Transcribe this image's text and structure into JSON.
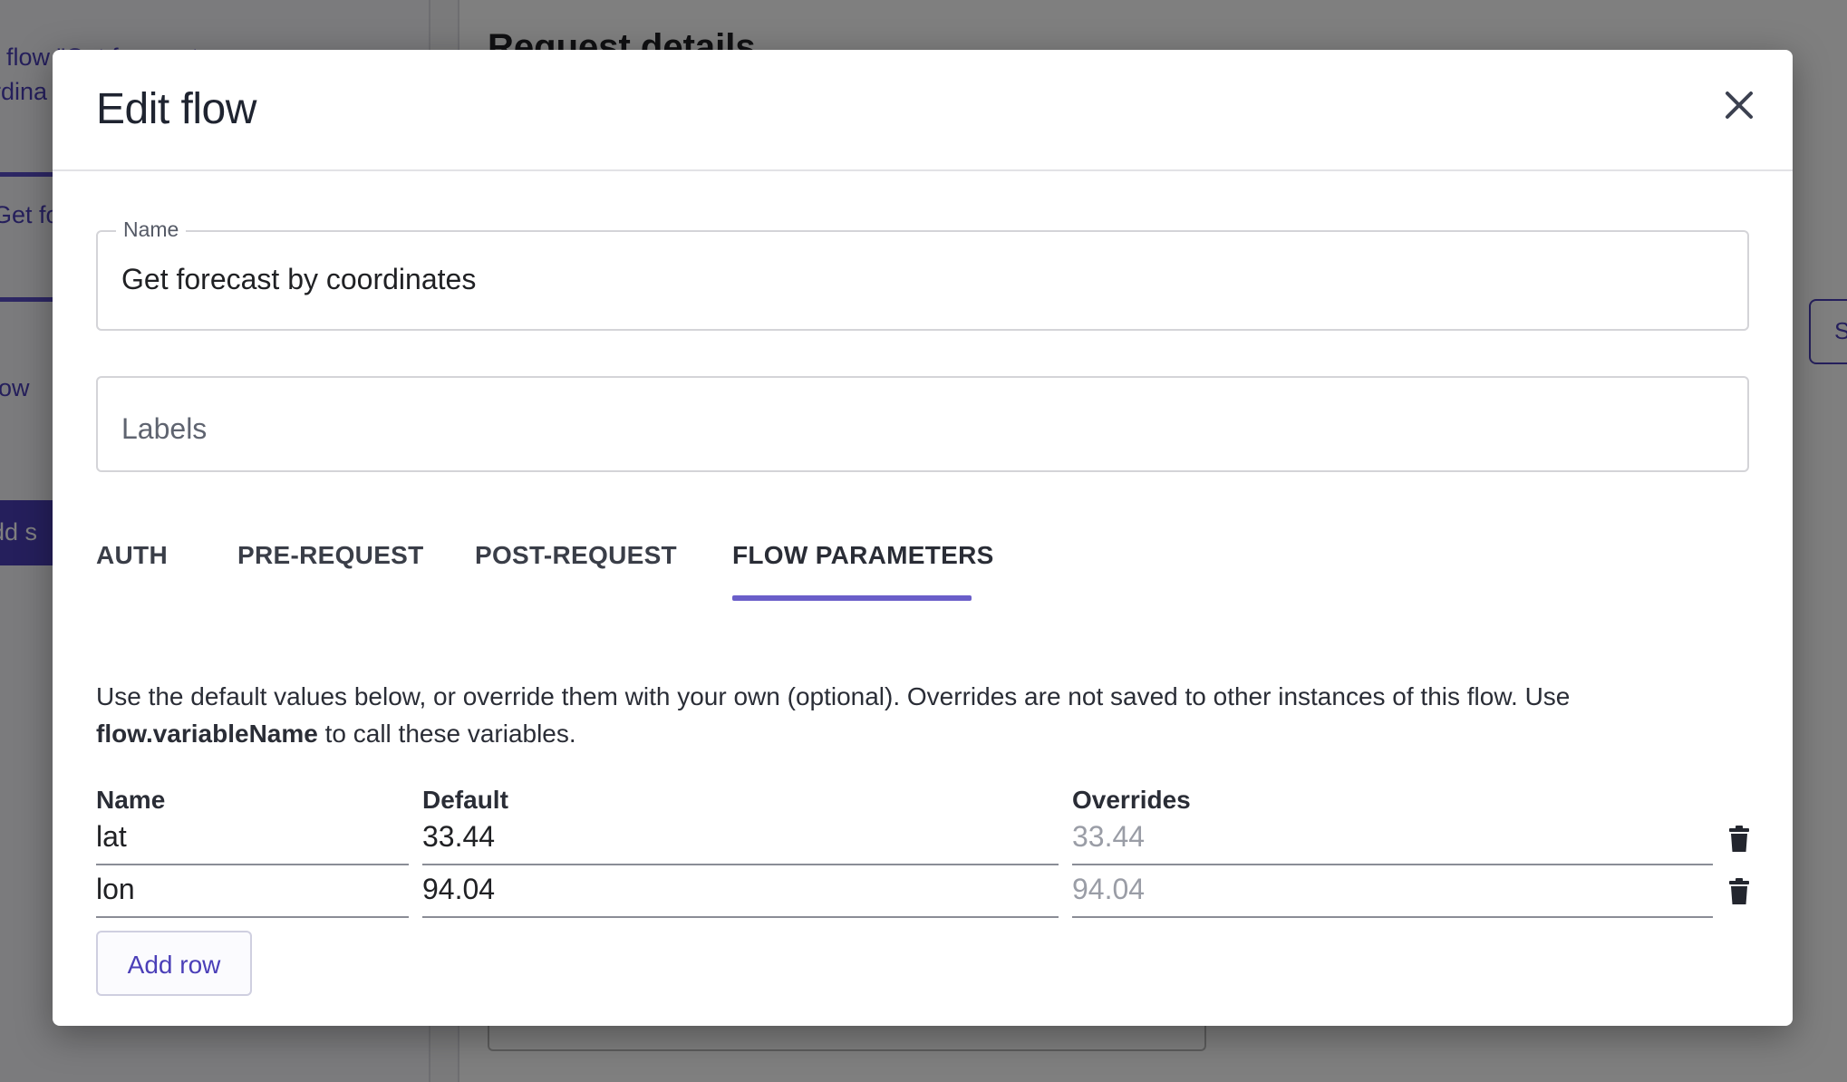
{
  "background": {
    "sidebar_flow_line1": "t flow \"Get forecast",
    "sidebar_flow_line2": "rdina",
    "sidebar_get_fo": "Get fo",
    "sidebar_low": "low",
    "sidebar_add_button": "dd s",
    "main_title": "Request details",
    "side_button": "S"
  },
  "modal": {
    "title": "Edit flow",
    "close_icon": "close-icon",
    "name_field": {
      "legend": "Name",
      "value": "Get forecast by coordinates"
    },
    "labels_field": {
      "placeholder": "Labels"
    },
    "tabs": [
      {
        "label": "AUTH",
        "active": false
      },
      {
        "label": "PRE-REQUEST",
        "active": false
      },
      {
        "label": "POST-REQUEST",
        "active": false
      },
      {
        "label": "FLOW PARAMETERS",
        "active": true
      }
    ],
    "description": {
      "part1": "Use the default values below, or override them with your own (optional). Overrides are not saved to other instances of this flow. Use ",
      "bold": "flow.variableName",
      "part2": " to call these variables."
    },
    "params": {
      "headers": {
        "name": "Name",
        "default": "Default",
        "overrides": "Overrides"
      },
      "rows": [
        {
          "name": "lat",
          "default": "33.44",
          "override_placeholder": "33.44"
        },
        {
          "name": "lon",
          "default": "94.04",
          "override_placeholder": "94.04"
        }
      ],
      "delete_icon": "trash-icon"
    },
    "add_row_label": "Add row"
  },
  "colors": {
    "accent": "#4b3fb8",
    "tab_underline": "#6a5ec9",
    "overlay": "rgba(0,0,0,0.5)"
  }
}
